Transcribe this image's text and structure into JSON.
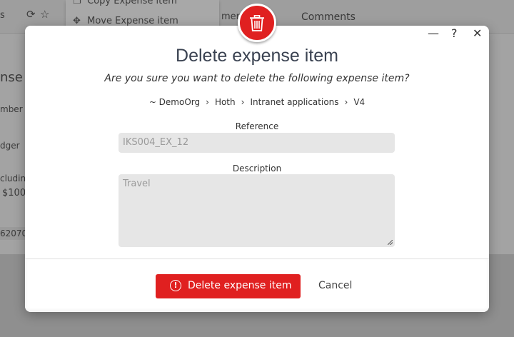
{
  "background": {
    "topbar_left_text": "s",
    "tab_comments_partial": "men",
    "tab_comments": "Comments",
    "menu_items": [
      {
        "icon": "copy-icon",
        "label": "Copy Expense item"
      },
      {
        "icon": "move-icon",
        "label": "Move Expense item"
      }
    ],
    "side_heading_partial": "nse i",
    "side_labels": [
      "mber",
      "dger",
      "cludin",
      "$100.",
      "62070"
    ]
  },
  "dialog": {
    "header_icon": "trash-icon",
    "window_controls": {
      "minimize": "—",
      "help": "?",
      "close": "✕"
    },
    "title": "Delete expense item",
    "subtitle": "Are you sure you want to delete the following expense item?",
    "breadcrumb": [
      "~ DemoOrg",
      "Hoth",
      "Intranet applications",
      "V4"
    ],
    "breadcrumb_separator": "›",
    "fields": {
      "reference": {
        "label": "Reference",
        "value": "IKS004_EX_12"
      },
      "description": {
        "label": "Description",
        "value": "Travel"
      }
    },
    "buttons": {
      "delete": {
        "label": "Delete expense item",
        "icon": "warning-circle-icon"
      },
      "cancel": {
        "label": "Cancel"
      }
    }
  },
  "colors": {
    "accent": "#e02020",
    "title": "#3a4251",
    "field_bg": "#e6e6e6",
    "overlay": "#9e9e9e"
  }
}
